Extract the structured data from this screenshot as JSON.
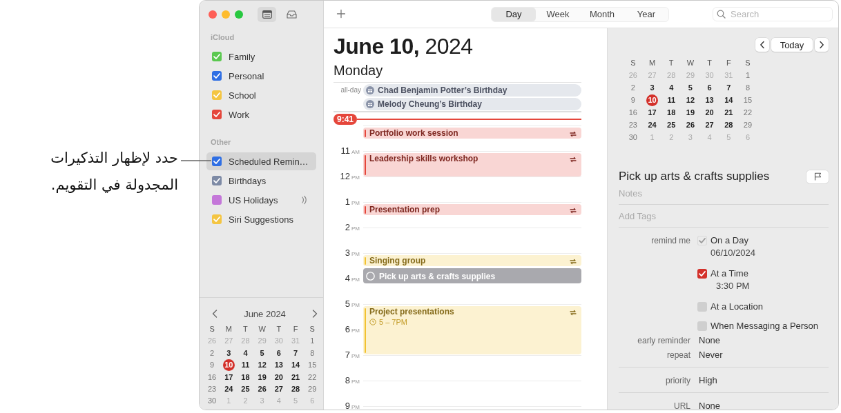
{
  "callout": {
    "text": "حدد لإظهار التذكيرات المجدولة في التقويم."
  },
  "sidebar": {
    "sections": [
      {
        "title": "iCloud",
        "calendars": [
          {
            "name": "Family",
            "color": "#5ac84f",
            "checked": true,
            "selected": false,
            "subscribed": false
          },
          {
            "name": "Personal",
            "color": "#2f6fe4",
            "checked": true,
            "selected": false,
            "subscribed": false
          },
          {
            "name": "School",
            "color": "#f4c542",
            "checked": true,
            "selected": false,
            "subscribed": false
          },
          {
            "name": "Work",
            "color": "#e5463b",
            "checked": true,
            "selected": false,
            "subscribed": false
          }
        ]
      },
      {
        "title": "Other",
        "calendars": [
          {
            "name": "Scheduled Remin…",
            "color": "#2f6fe4",
            "checked": true,
            "selected": true,
            "subscribed": false
          },
          {
            "name": "Birthdays",
            "color": "#7d8aa5",
            "checked": true,
            "selected": false,
            "subscribed": false
          },
          {
            "name": "US Holidays",
            "color": "#c477d9",
            "checked": false,
            "selected": false,
            "subscribed": true
          },
          {
            "name": "Siri Suggestions",
            "color": "#f4c542",
            "checked": true,
            "selected": false,
            "subscribed": false
          }
        ]
      }
    ],
    "mini_calendar": {
      "title": "June 2024",
      "weekdays": [
        "S",
        "M",
        "T",
        "W",
        "T",
        "F",
        "S"
      ],
      "weeks": [
        [
          {
            "day": "26",
            "muted": true,
            "selected": false
          },
          {
            "day": "27",
            "muted": true,
            "selected": false
          },
          {
            "day": "28",
            "muted": true,
            "selected": false
          },
          {
            "day": "29",
            "muted": true,
            "selected": false
          },
          {
            "day": "30",
            "muted": true,
            "selected": false
          },
          {
            "day": "31",
            "muted": true,
            "selected": false
          },
          {
            "day": "1",
            "muted": false,
            "selected": false
          }
        ],
        [
          {
            "day": "2",
            "muted": false,
            "selected": false
          },
          {
            "day": "3",
            "muted": false,
            "selected": false
          },
          {
            "day": "4",
            "muted": false,
            "selected": false
          },
          {
            "day": "5",
            "muted": false,
            "selected": false
          },
          {
            "day": "6",
            "muted": false,
            "selected": false
          },
          {
            "day": "7",
            "muted": false,
            "selected": false
          },
          {
            "day": "8",
            "muted": false,
            "selected": false
          }
        ],
        [
          {
            "day": "9",
            "muted": false,
            "selected": false
          },
          {
            "day": "10",
            "muted": false,
            "selected": true
          },
          {
            "day": "11",
            "muted": false,
            "selected": false
          },
          {
            "day": "12",
            "muted": false,
            "selected": false
          },
          {
            "day": "13",
            "muted": false,
            "selected": false
          },
          {
            "day": "14",
            "muted": false,
            "selected": false
          },
          {
            "day": "15",
            "muted": false,
            "selected": false
          }
        ],
        [
          {
            "day": "16",
            "muted": false,
            "selected": false
          },
          {
            "day": "17",
            "muted": false,
            "selected": false
          },
          {
            "day": "18",
            "muted": false,
            "selected": false
          },
          {
            "day": "19",
            "muted": false,
            "selected": false
          },
          {
            "day": "20",
            "muted": false,
            "selected": false
          },
          {
            "day": "21",
            "muted": false,
            "selected": false
          },
          {
            "day": "22",
            "muted": false,
            "selected": false
          }
        ],
        [
          {
            "day": "23",
            "muted": false,
            "selected": false
          },
          {
            "day": "24",
            "muted": false,
            "selected": false
          },
          {
            "day": "25",
            "muted": false,
            "selected": false
          },
          {
            "day": "26",
            "muted": false,
            "selected": false
          },
          {
            "day": "27",
            "muted": false,
            "selected": false
          },
          {
            "day": "28",
            "muted": false,
            "selected": false
          },
          {
            "day": "29",
            "muted": false,
            "selected": false
          }
        ],
        [
          {
            "day": "30",
            "muted": false,
            "selected": false
          },
          {
            "day": "1",
            "muted": true,
            "selected": false
          },
          {
            "day": "2",
            "muted": true,
            "selected": false
          },
          {
            "day": "3",
            "muted": true,
            "selected": false
          },
          {
            "day": "4",
            "muted": true,
            "selected": false
          },
          {
            "day": "5",
            "muted": true,
            "selected": false
          },
          {
            "day": "6",
            "muted": true,
            "selected": false
          }
        ]
      ]
    }
  },
  "toolbar": {
    "views": [
      {
        "label": "Day",
        "selected": true
      },
      {
        "label": "Week",
        "selected": false
      },
      {
        "label": "Month",
        "selected": false
      },
      {
        "label": "Year",
        "selected": false
      }
    ],
    "search": {
      "placeholder": "Search"
    }
  },
  "day_view": {
    "date": "**June 10,** 2024",
    "weekday": "Monday",
    "all_day_label": "all-day",
    "all_day": [
      {
        "title": "Chad Benjamin Potter’s Birthday"
      },
      {
        "title": "Melody Cheung’s Birthday"
      }
    ],
    "now": "9:41",
    "hours": [
      {
        "events": [
          {
            "title": "Portfolio work session",
            "kind": "short",
            "color": "#e5463b",
            "repeats": true
          }
        ]
      },
      {
        "label": "11",
        "period": "AM",
        "events": [
          {
            "title": "Leadership skills workshop",
            "kind": "hour",
            "color": "#e5463b",
            "repeats": true
          }
        ]
      },
      {
        "label": "12",
        "period": "PM"
      },
      {
        "label": "1",
        "period": "PM",
        "events": [
          {
            "title": "Presentation prep",
            "kind": "short",
            "color": "#e5463b",
            "repeats": true
          }
        ]
      },
      {
        "label": "2",
        "period": "PM"
      },
      {
        "label": "3",
        "period": "PM",
        "events": [
          {
            "title": "Singing group",
            "kind": "short",
            "color": "#f2c230",
            "repeats": true
          },
          {
            "title": "Pick up arts & crafts supplies",
            "kind": "reminder",
            "completed": false,
            "repeats": false
          }
        ]
      },
      {
        "label": "4",
        "period": "PM"
      },
      {
        "label": "5",
        "period": "PM",
        "events": [
          {
            "title": "Project presentations",
            "kind": "long",
            "color": "#f2c230",
            "repeats": true,
            "time": "5 – 7PM"
          }
        ]
      },
      {
        "label": "6",
        "period": "PM"
      },
      {
        "label": "7",
        "period": "PM"
      },
      {
        "label": "8",
        "period": "PM"
      },
      {
        "label": "9",
        "period": "PM"
      }
    ]
  },
  "inspector": {
    "today_button": "Today",
    "mini_calendar": {
      "weekdays": [
        "S",
        "M",
        "T",
        "W",
        "T",
        "F",
        "S"
      ],
      "weeks": [
        [
          {
            "day": "26",
            "muted": true,
            "selected": false
          },
          {
            "day": "27",
            "muted": true,
            "selected": false
          },
          {
            "day": "28",
            "muted": true,
            "selected": false
          },
          {
            "day": "29",
            "muted": true,
            "selected": false
          },
          {
            "day": "30",
            "muted": true,
            "selected": false
          },
          {
            "day": "31",
            "muted": true,
            "selected": false
          },
          {
            "day": "1",
            "muted": false,
            "selected": false
          }
        ],
        [
          {
            "day": "2",
            "muted": false,
            "selected": false
          },
          {
            "day": "3",
            "muted": false,
            "selected": false
          },
          {
            "day": "4",
            "muted": false,
            "selected": false
          },
          {
            "day": "5",
            "muted": false,
            "selected": false
          },
          {
            "day": "6",
            "muted": false,
            "selected": false
          },
          {
            "day": "7",
            "muted": false,
            "selected": false
          },
          {
            "day": "8",
            "muted": false,
            "selected": false
          }
        ],
        [
          {
            "day": "9",
            "muted": false,
            "selected": false
          },
          {
            "day": "10",
            "muted": false,
            "selected": true
          },
          {
            "day": "11",
            "muted": false,
            "selected": false
          },
          {
            "day": "12",
            "muted": false,
            "selected": false
          },
          {
            "day": "13",
            "muted": false,
            "selected": false
          },
          {
            "day": "14",
            "muted": false,
            "selected": false
          },
          {
            "day": "15",
            "muted": false,
            "selected": false
          }
        ],
        [
          {
            "day": "16",
            "muted": false,
            "selected": false
          },
          {
            "day": "17",
            "muted": false,
            "selected": false
          },
          {
            "day": "18",
            "muted": false,
            "selected": false
          },
          {
            "day": "19",
            "muted": false,
            "selected": false
          },
          {
            "day": "20",
            "muted": false,
            "selected": false
          },
          {
            "day": "21",
            "muted": false,
            "selected": false
          },
          {
            "day": "22",
            "muted": false,
            "selected": false
          }
        ],
        [
          {
            "day": "23",
            "muted": false,
            "selected": false
          },
          {
            "day": "24",
            "muted": false,
            "selected": false
          },
          {
            "day": "25",
            "muted": false,
            "selected": false
          },
          {
            "day": "26",
            "muted": false,
            "selected": false
          },
          {
            "day": "27",
            "muted": false,
            "selected": false
          },
          {
            "day": "28",
            "muted": false,
            "selected": false
          },
          {
            "day": "29",
            "muted": false,
            "selected": false
          }
        ],
        [
          {
            "day": "30",
            "muted": false,
            "selected": false
          },
          {
            "day": "1",
            "muted": true,
            "selected": false
          },
          {
            "day": "2",
            "muted": true,
            "selected": false
          },
          {
            "day": "3",
            "muted": true,
            "selected": false
          },
          {
            "day": "4",
            "muted": true,
            "selected": false
          },
          {
            "day": "5",
            "muted": true,
            "selected": false
          },
          {
            "day": "6",
            "muted": true,
            "selected": false
          }
        ]
      ]
    },
    "reminder": {
      "title": "Pick up arts & crafts supplies",
      "flagged": false,
      "notes_placeholder": "Notes",
      "tags_placeholder": "Add Tags",
      "groups": [
        {
          "fields": [
            {
              "label": "remind me",
              "kind": "options",
              "options": [
                {
                  "label": "On a Day",
                  "checked": true,
                  "disabled": true,
                  "detail": "06/10/2024"
                },
                {
                  "label": "At a Time",
                  "checked": true,
                  "disabled": false,
                  "detail": "3:30 PM"
                },
                {
                  "label": "At a Location",
                  "checked": false,
                  "disabled": false
                },
                {
                  "label": "When Messaging a Person",
                  "checked": false,
                  "disabled": false
                }
              ]
            },
            {
              "label": "early reminder",
              "kind": "value",
              "value": "None"
            },
            {
              "label": "repeat",
              "kind": "value",
              "value": "Never"
            }
          ]
        },
        {
          "fields": [
            {
              "label": "priority",
              "kind": "value",
              "value": "High"
            }
          ]
        },
        {
          "fields": [
            {
              "label": "URL",
              "kind": "value",
              "value": "None"
            }
          ]
        }
      ]
    }
  }
}
